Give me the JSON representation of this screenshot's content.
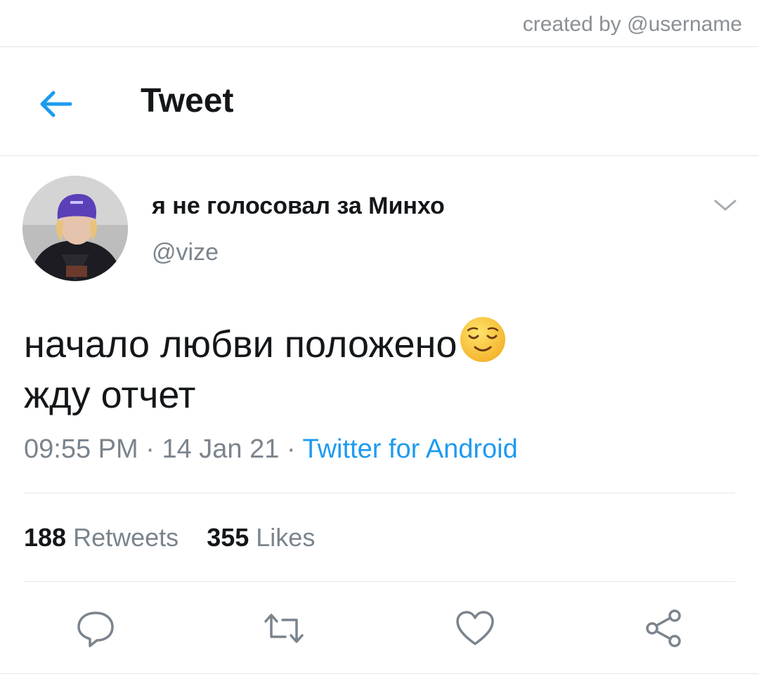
{
  "watermark": "created by @username",
  "header": {
    "title": "Tweet",
    "back_icon": "arrow-left-icon"
  },
  "tweet": {
    "display_name": "я не голосовал за Минхо",
    "handle": "@vize",
    "text_line1": "начало любви положено",
    "text_line2": "жду отчет",
    "emoji": "relieved-face-emoji",
    "time": "09:55 PM",
    "date": "14 Jan 21",
    "separator": " · ",
    "source": "Twitter for Android",
    "retweets_count": "188",
    "retweets_label": "Retweets",
    "likes_count": "355",
    "likes_label": "Likes"
  },
  "actions": [
    "reply-icon",
    "retweet-icon",
    "like-icon",
    "share-icon"
  ],
  "colors": {
    "accent": "#1d9bf0",
    "text": "#14171a",
    "muted": "#7b848d",
    "divider": "#e3e6e9"
  }
}
